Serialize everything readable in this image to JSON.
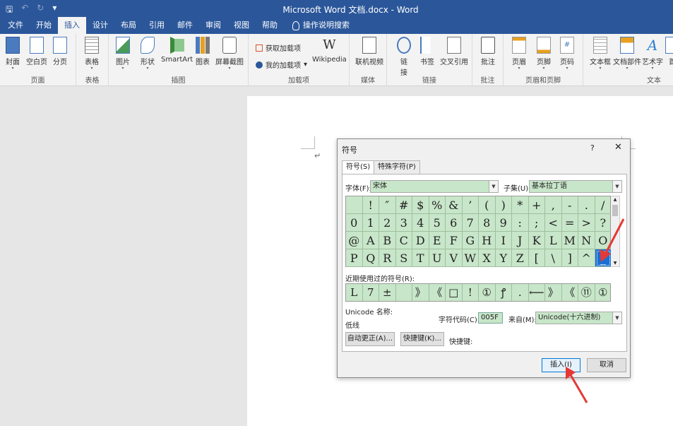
{
  "titlebar": {
    "title": "Microsoft Word 文档.docx  -  Word",
    "qat": [
      "save-icon",
      "undo-icon",
      "redo-icon",
      "customize-icon"
    ]
  },
  "menu": {
    "items": [
      "文件",
      "开始",
      "插入",
      "设计",
      "布局",
      "引用",
      "邮件",
      "审阅",
      "视图",
      "帮助"
    ],
    "active": "插入",
    "tell_me": "操作说明搜索"
  },
  "ribbon": {
    "groups": {
      "pages": "页面",
      "tables": "表格",
      "illustrations": "插图",
      "addins": "加载项",
      "media": "媒体",
      "links": "链接",
      "comments": "批注",
      "header_footer": "页眉和页脚",
      "text": "文本"
    },
    "buttons": {
      "cover": "封面",
      "blank": "空白页",
      "pagebreak": "分页",
      "table": "表格",
      "picture": "图片",
      "shapes": "形状",
      "smartart": "SmartArt",
      "chart": "图表",
      "screenshot": "屏幕截图",
      "get_addins": "获取加载项",
      "my_addins": "我的加载项",
      "wikipedia": "Wikipedia",
      "online_video": "联机视频",
      "link_l1": "链",
      "link_l2": "接",
      "bookmark": "书签",
      "crossref": "交叉引用",
      "comment": "批注",
      "header": "页眉",
      "footer": "页脚",
      "pagenum": "页码",
      "textbox": "文本框",
      "quickparts": "文档部件",
      "wordart": "艺术字",
      "dropcap": "首"
    },
    "wiki_glyph": "W"
  },
  "dialog": {
    "title": "符号",
    "help": "?",
    "close": "✕",
    "tabs": [
      "符号(S)",
      "特殊字符(P)"
    ],
    "font_label": "字体(F):",
    "font_value": "宋体",
    "subset_label": "子集(U):",
    "subset_value": "基本拉丁语",
    "grid": [
      [
        "",
        " ",
        "!",
        "″",
        "#",
        "$",
        "%",
        "&",
        "’",
        "(",
        ")",
        "*",
        "+",
        ",",
        "-",
        ".",
        "/"
      ],
      [
        "0",
        "1",
        "2",
        "3",
        "4",
        "5",
        "6",
        "7",
        "8",
        "9",
        ":",
        ";",
        "<",
        "=",
        ">",
        "?"
      ],
      [
        "@",
        "A",
        "B",
        "C",
        "D",
        "E",
        "F",
        "G",
        "H",
        "I",
        "J",
        "K",
        "L",
        "M",
        "N",
        "O"
      ],
      [
        "P",
        "Q",
        "R",
        "S",
        "T",
        "U",
        "V",
        "W",
        "X",
        "Y",
        "Z",
        "[",
        "\\",
        "]",
        "^",
        "_"
      ]
    ],
    "selected_symbol": "_",
    "recent_label": "近期使用过的符号(R):",
    "recent": [
      "L",
      "7",
      "±",
      "",
      "》",
      "《",
      "□",
      "!",
      "①",
      "ꝭ",
      ".",
      "⟵",
      "》",
      "《",
      "⑪",
      "①"
    ],
    "unicode_name_label": "Unicode 名称:",
    "unicode_name": "低线",
    "char_code_label": "字符代码(C):",
    "char_code": "005F",
    "from_label": "来自(M):",
    "from_value": "Unicode(十六进制)",
    "autocorrect": "自动更正(A)...",
    "shortcut_key": "快捷键(K)...",
    "shortcut_label": "快捷键:",
    "insert": "插入(I)",
    "cancel": "取消"
  },
  "colors": {
    "accent": "#2b579a",
    "highlight": "#c8e6c9",
    "selection": "#1a6fd4",
    "arrow": "#e53935"
  }
}
